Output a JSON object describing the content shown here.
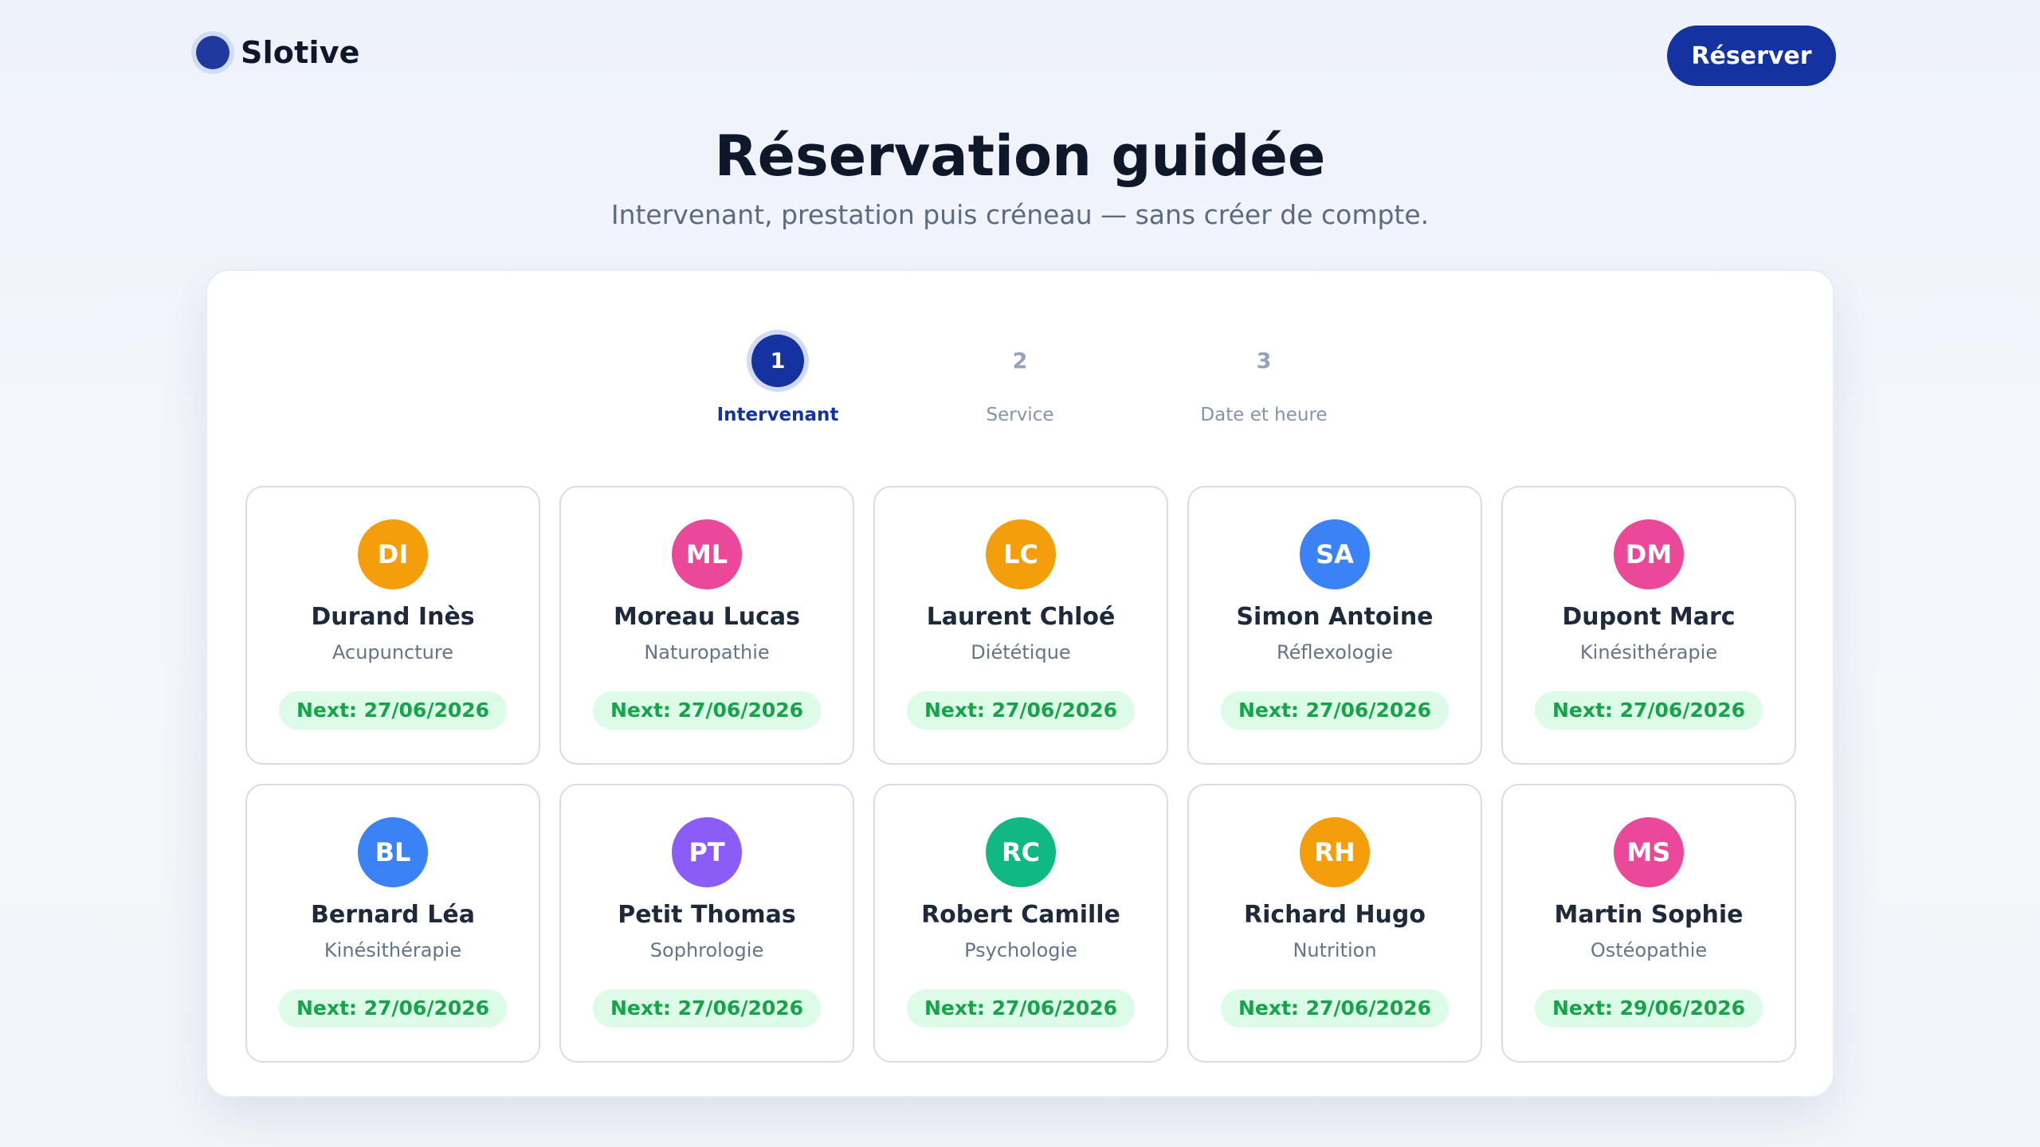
{
  "header": {
    "brand": "Slotive",
    "cta_label": "Réserver"
  },
  "hero": {
    "title": "Réservation guidée",
    "subtitle": "Intervenant, prestation puis créneau — sans créer de compte."
  },
  "stepper": {
    "steps": [
      {
        "number": "1",
        "label": "Intervenant",
        "active": true
      },
      {
        "number": "2",
        "label": "Service",
        "active": false
      },
      {
        "number": "3",
        "label": "Date et heure",
        "active": false
      }
    ]
  },
  "practitioners": [
    {
      "initials": "DI",
      "name": "Durand Inès",
      "specialty": "Acupuncture",
      "next": "Next: 27/06/2026",
      "color": "#f59e0b"
    },
    {
      "initials": "ML",
      "name": "Moreau Lucas",
      "specialty": "Naturopathie",
      "next": "Next: 27/06/2026",
      "color": "#ec4899"
    },
    {
      "initials": "LC",
      "name": "Laurent Chloé",
      "specialty": "Diététique",
      "next": "Next: 27/06/2026",
      "color": "#f59e0b"
    },
    {
      "initials": "SA",
      "name": "Simon Antoine",
      "specialty": "Réflexologie",
      "next": "Next: 27/06/2026",
      "color": "#3b82f6"
    },
    {
      "initials": "DM",
      "name": "Dupont Marc",
      "specialty": "Kinésithérapie",
      "next": "Next: 27/06/2026",
      "color": "#ec4899"
    },
    {
      "initials": "BL",
      "name": "Bernard Léa",
      "specialty": "Kinésithérapie",
      "next": "Next: 27/06/2026",
      "color": "#3b82f6"
    },
    {
      "initials": "PT",
      "name": "Petit Thomas",
      "specialty": "Sophrologie",
      "next": "Next: 27/06/2026",
      "color": "#8b5cf6"
    },
    {
      "initials": "RC",
      "name": "Robert Camille",
      "specialty": "Psychologie",
      "next": "Next: 27/06/2026",
      "color": "#10b981"
    },
    {
      "initials": "RH",
      "name": "Richard Hugo",
      "specialty": "Nutrition",
      "next": "Next: 27/06/2026",
      "color": "#f59e0b"
    },
    {
      "initials": "MS",
      "name": "Martin Sophie",
      "specialty": "Ostéopathie",
      "next": "Next: 29/06/2026",
      "color": "#ec4899"
    }
  ],
  "colors": {
    "primary": "#1533a0",
    "next_badge_bg": "#dcfce7",
    "next_badge_text": "#16a34a"
  }
}
